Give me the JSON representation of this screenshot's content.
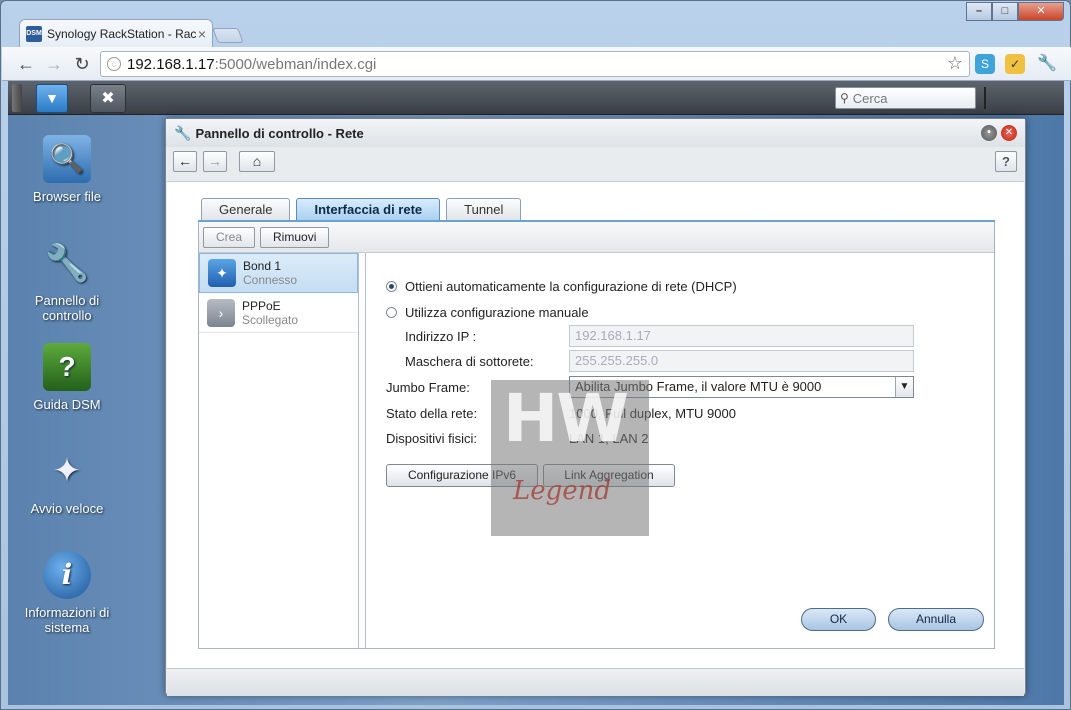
{
  "browser": {
    "tab_title": "Synology RackStation - Rac",
    "tab_close": "×",
    "favicon_text": "DSM",
    "url_host": "192.168.1.17",
    "url_rest": ":5000/webman/index.cgi",
    "win_min": "–",
    "win_max": "□",
    "win_close": "✕",
    "back": "←",
    "forward": "→",
    "reload": "↻",
    "star": "☆"
  },
  "dsm": {
    "search_placeholder": "Cerca",
    "main_menu_icon": "chevron-down-icon",
    "control_panel_icon": "tools-icon"
  },
  "desktop": {
    "icons": [
      {
        "label": "Browser file"
      },
      {
        "label": "Pannello di controllo"
      },
      {
        "label": "Guida DSM"
      },
      {
        "label": "Avvio veloce"
      },
      {
        "label": "Informazioni di sistema"
      }
    ]
  },
  "window": {
    "title": "Pannello di controllo - Rete",
    "help": "?",
    "tabs": [
      {
        "label": "Generale"
      },
      {
        "label": "Interfaccia di rete"
      },
      {
        "label": "Tunnel"
      }
    ],
    "buttons": {
      "create": "Crea",
      "remove": "Rimuovi"
    },
    "interfaces": [
      {
        "name": "Bond 1",
        "status": "Connesso"
      },
      {
        "name": "PPPoE",
        "status": "Scollegato"
      }
    ],
    "form": {
      "dhcp_option": "Ottieni automaticamente la configurazione di rete (DHCP)",
      "manual_option": "Utilizza configurazione manuale",
      "ip_label": "Indirizzo IP :",
      "ip_value": "192.168.1.17",
      "mask_label": "Maschera di sottorete:",
      "mask_value": "255.255.255.0",
      "jumbo_label": "Jumbo Frame:",
      "jumbo_value": "Abilita Jumbo Frame, il valore MTU è 9000",
      "status_label": "Stato della rete:",
      "status_value": "1000, Full duplex, MTU 9000",
      "devices_label": "Dispositivi fisici:",
      "devices_value": "LAN 1, LAN 2",
      "ipv6_button": "Configurazione IPv6",
      "link_agg_button": "Link Aggregation",
      "ok_button": "OK",
      "cancel_button": "Annulla"
    },
    "watermark": {
      "top": "HW",
      "bottom": "Legend"
    }
  },
  "colors": {
    "accent": "#6aa3d3",
    "dsm_bar": "#3a3f46",
    "desktop": "#5b82ae"
  }
}
